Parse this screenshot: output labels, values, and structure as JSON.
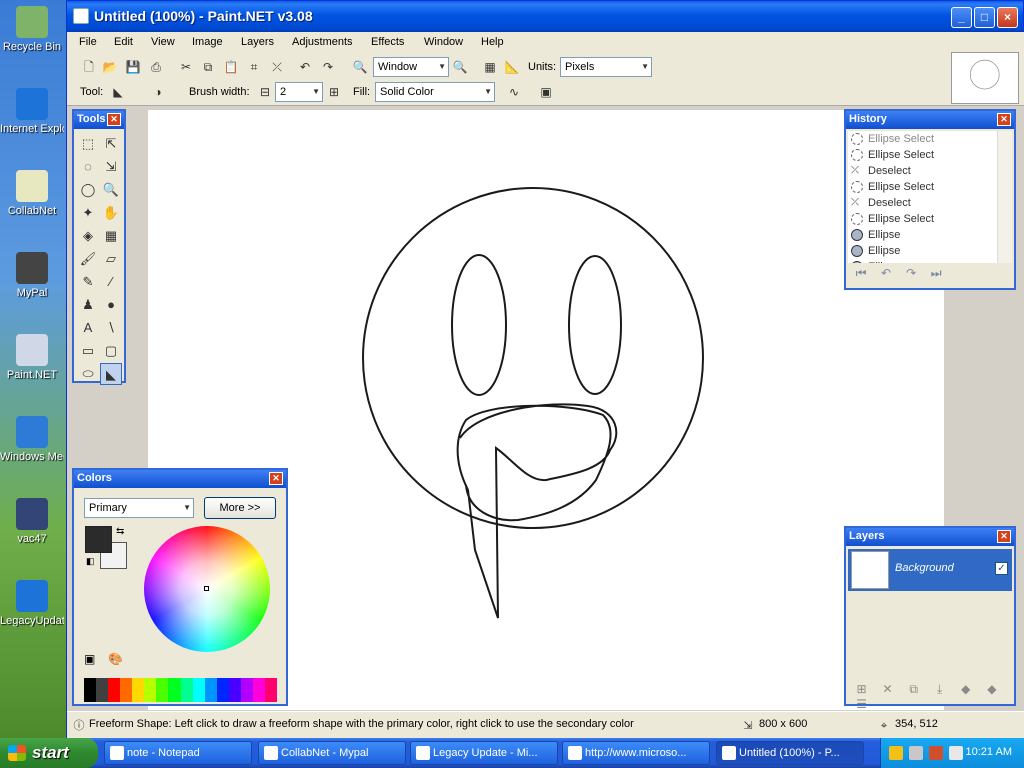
{
  "desktop": {
    "icons": [
      {
        "label": "Recycle Bin",
        "icon": "recycle-bin-icon",
        "color": "#7fb36a"
      },
      {
        "label": "Internet Explorer",
        "icon": "internet-explorer-icon",
        "color": "#1e73d8"
      },
      {
        "label": "CollabNet",
        "icon": "collabnet-icon",
        "color": "#e8e8c0"
      },
      {
        "label": "MyPal",
        "icon": "mypal-icon",
        "color": "#444444"
      },
      {
        "label": "Paint.NET",
        "icon": "paintnet-icon",
        "color": "#d0d8e8"
      },
      {
        "label": "Windows Media Player",
        "icon": "media-player-icon",
        "color": "#2d7bd6"
      },
      {
        "label": "vac47",
        "icon": "archive-icon",
        "color": "#334477"
      },
      {
        "label": "LegacyUpdate",
        "icon": "legacy-update-icon",
        "color": "#1e73d8"
      }
    ]
  },
  "window": {
    "title": "Untitled (100%) - Paint.NET v3.08",
    "controls": {
      "minimize": "_",
      "maximize": "□",
      "close": "×"
    }
  },
  "menu": [
    "File",
    "Edit",
    "View",
    "Image",
    "Layers",
    "Adjustments",
    "Effects",
    "Window",
    "Help"
  ],
  "toolbar": {
    "zoom_combo": "Window",
    "units_label": "Units:",
    "units_value": "Pixels",
    "tool_label": "Tool:",
    "brush_width_label": "Brush width:",
    "brush_width_value": "2",
    "fill_label": "Fill:",
    "fill_value": "Solid Color"
  },
  "tools_panel": {
    "title": "Tools",
    "tools": [
      {
        "name": "rectangle-select-icon",
        "glyph": "⬚"
      },
      {
        "name": "move-selection-icon",
        "glyph": "⇱"
      },
      {
        "name": "lasso-select-icon",
        "glyph": "◌"
      },
      {
        "name": "move-selected-icon",
        "glyph": "⇲"
      },
      {
        "name": "ellipse-select-icon",
        "glyph": "◯"
      },
      {
        "name": "zoom-icon",
        "glyph": "🔍"
      },
      {
        "name": "magic-wand-icon",
        "glyph": "✦"
      },
      {
        "name": "pan-icon",
        "glyph": "✋"
      },
      {
        "name": "paint-bucket-icon",
        "glyph": "◈"
      },
      {
        "name": "gradient-icon",
        "glyph": "▦"
      },
      {
        "name": "paintbrush-icon",
        "glyph": "🖌"
      },
      {
        "name": "eraser-icon",
        "glyph": "▱"
      },
      {
        "name": "pencil-icon",
        "glyph": "✎"
      },
      {
        "name": "color-picker-icon",
        "glyph": "⁄"
      },
      {
        "name": "clone-stamp-icon",
        "glyph": "♟"
      },
      {
        "name": "recolor-icon",
        "glyph": "●"
      },
      {
        "name": "text-icon",
        "glyph": "A"
      },
      {
        "name": "line-curve-icon",
        "glyph": "∖"
      },
      {
        "name": "rectangle-icon",
        "glyph": "▭"
      },
      {
        "name": "rounded-rectangle-icon",
        "glyph": "▢"
      },
      {
        "name": "ellipse-icon",
        "glyph": "⬭"
      },
      {
        "name": "freeform-shape-icon",
        "glyph": "◣"
      }
    ]
  },
  "history_panel": {
    "title": "History",
    "items": [
      {
        "label": "Ellipse Select",
        "kind": "dashed",
        "dim": true
      },
      {
        "label": "Ellipse Select",
        "kind": "dashed"
      },
      {
        "label": "Deselect",
        "kind": "x"
      },
      {
        "label": "Ellipse Select",
        "kind": "dashed"
      },
      {
        "label": "Deselect",
        "kind": "x"
      },
      {
        "label": "Ellipse Select",
        "kind": "dashed"
      },
      {
        "label": "Ellipse",
        "kind": "solid"
      },
      {
        "label": "Ellipse",
        "kind": "solid"
      },
      {
        "label": "Ellipse",
        "kind": "solid"
      }
    ]
  },
  "colors_panel": {
    "title": "Colors",
    "mode": "Primary",
    "more_button": "More >>",
    "primary_color": "#2b2b2b",
    "secondary_color": "#f2f2f2",
    "palette": [
      "#000000",
      "#404040",
      "#ff0000",
      "#ff6a00",
      "#ffd800",
      "#b6ff00",
      "#4cff00",
      "#00ff21",
      "#00ff90",
      "#00ffff",
      "#0094ff",
      "#0026ff",
      "#4800ff",
      "#b200ff",
      "#ff00dc",
      "#ff006e"
    ]
  },
  "layers_panel": {
    "title": "Layers",
    "layers": [
      {
        "name": "Background",
        "visible": true
      }
    ]
  },
  "status": {
    "hint": "Freeform Shape: Left click to draw a freeform shape with the primary color, right click to use the secondary color",
    "image_size": "800 x 600",
    "cursor_pos": "354, 512"
  },
  "taskbar": {
    "start": "start",
    "tasks": [
      {
        "label": "note - Notepad",
        "active": false
      },
      {
        "label": "CollabNet - Mypal",
        "active": false
      },
      {
        "label": "Legacy Update - Mi...",
        "active": false
      },
      {
        "label": "http://www.microso...",
        "active": false
      },
      {
        "label": "Untitled (100%) - P...",
        "active": true
      }
    ],
    "clock": "10:21 AM"
  }
}
